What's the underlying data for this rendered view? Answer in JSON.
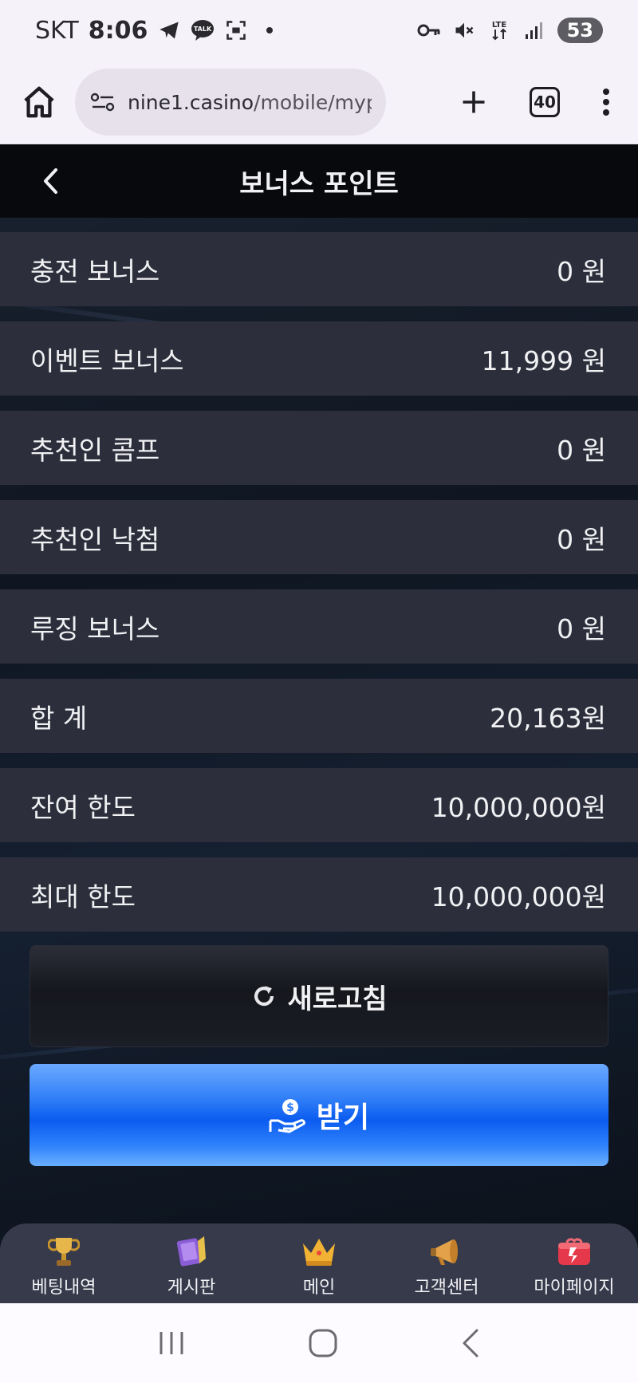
{
  "status_bar": {
    "carrier": "SKT",
    "time": "8:06",
    "battery": "53"
  },
  "browser": {
    "url_host": "nine1.casino",
    "url_path": "/mobile/mypa",
    "tab_count": "40"
  },
  "page": {
    "title": "보너스 포인트"
  },
  "rows": [
    {
      "label": "충전 보너스",
      "value": "0 원"
    },
    {
      "label": "이벤트 보너스",
      "value": "11,999 원"
    },
    {
      "label": "추천인 콤프",
      "value": "0 원"
    },
    {
      "label": "추천인 낙첨",
      "value": "0 원"
    },
    {
      "label": "루징 보너스",
      "value": "0 원"
    },
    {
      "label": "합 계",
      "value": "20,163원"
    },
    {
      "label": "잔여 한도",
      "value": "10,000,000원"
    },
    {
      "label": "최대 한도",
      "value": "10,000,000원"
    }
  ],
  "buttons": {
    "refresh": "새로고침",
    "receive": "받기"
  },
  "nav": [
    {
      "label": "베팅내역",
      "icon": "trophy-icon"
    },
    {
      "label": "게시판",
      "icon": "board-icon"
    },
    {
      "label": "메인",
      "icon": "crown-icon"
    },
    {
      "label": "고객센터",
      "icon": "megaphone-icon"
    },
    {
      "label": "마이페이지",
      "icon": "gift-icon"
    }
  ],
  "colors": {
    "accent": "#0b5cf0",
    "row_bg": "#2c2f3b",
    "header_bg": "#08090c",
    "nav_bg": "#363a4b"
  }
}
